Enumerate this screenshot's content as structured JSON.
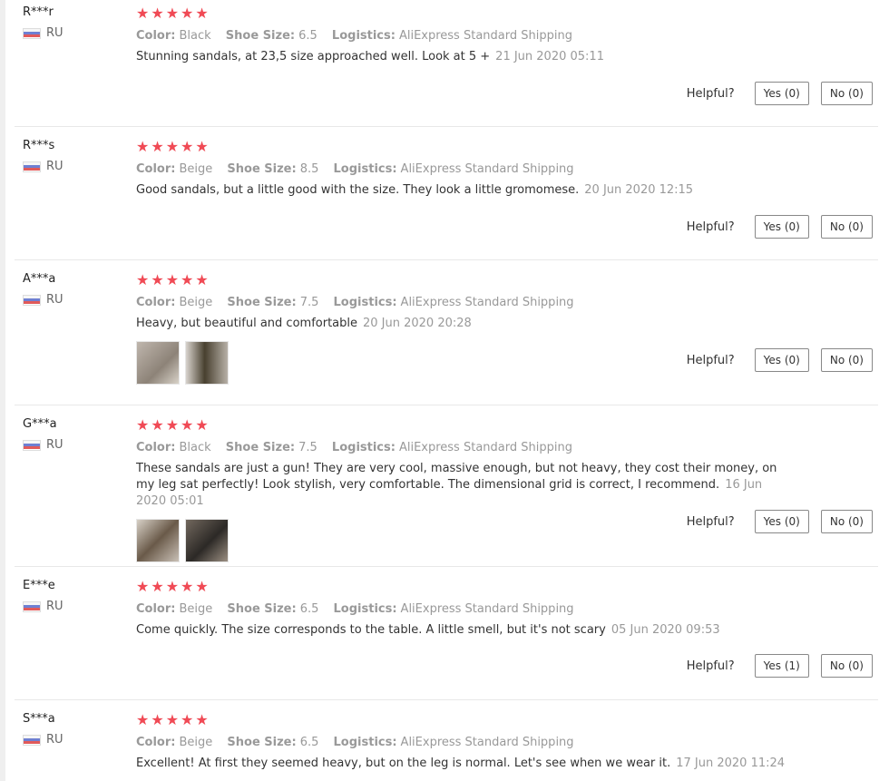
{
  "labels": {
    "color": "Color:",
    "size": "Shoe Size:",
    "logistics": "Logistics:",
    "helpful": "Helpful?"
  },
  "stars": "★★★★★",
  "reviews": [
    {
      "user": "R***r",
      "country": "RU",
      "color": "Black",
      "size": "6.5",
      "logistics": "AliExpress Standard Shipping",
      "text": "Stunning sandals, at 23,5 size approached well. Look at 5 +",
      "date": "21 Jun 2020 05:11",
      "yes": "Yes (0)",
      "no": "No (0)",
      "photos": []
    },
    {
      "user": "R***s",
      "country": "RU",
      "color": "Beige",
      "size": "8.5",
      "logistics": "AliExpress Standard Shipping",
      "text": "Good sandals, but a little good with the size. They look a little gromomese.",
      "date": "20 Jun 2020 12:15",
      "yes": "Yes (0)",
      "no": "No (0)",
      "photos": []
    },
    {
      "user": "A***a",
      "country": "RU",
      "color": "Beige",
      "size": "7.5",
      "logistics": "AliExpress Standard Shipping",
      "text": "Heavy, but beautiful and comfortable",
      "date": "20 Jun 2020 20:28",
      "yes": "Yes (0)",
      "no": "No (0)",
      "photos": [
        "photo-1",
        "photo-2"
      ]
    },
    {
      "user": "G***a",
      "country": "RU",
      "color": "Black",
      "size": "7.5",
      "logistics": "AliExpress Standard Shipping",
      "text": "These sandals are just a gun! They are very cool, massive enough, but not heavy, they cost their money, on my leg sat perfectly! Look stylish, very comfortable. The dimensional grid is correct, I recommend.",
      "date": "16 Jun 2020 05:01",
      "yes": "Yes (0)",
      "no": "No (0)",
      "photos": [
        "photo-1",
        "photo-2"
      ]
    },
    {
      "user": "E***e",
      "country": "RU",
      "color": "Beige",
      "size": "6.5",
      "logistics": "AliExpress Standard Shipping",
      "text": "Come quickly. The size corresponds to the table. A little smell, but it's not scary",
      "date": "05 Jun 2020 09:53",
      "yes": "Yes (1)",
      "no": "No (0)",
      "photos": []
    },
    {
      "user": "S***a",
      "country": "RU",
      "color": "Beige",
      "size": "6.5",
      "logistics": "AliExpress Standard Shipping",
      "text": "Excellent! At first they seemed heavy, but on the leg is normal. Let's see when we wear it.",
      "date": "17 Jun 2020 11:24",
      "yes": "",
      "no": "",
      "photos": []
    }
  ]
}
